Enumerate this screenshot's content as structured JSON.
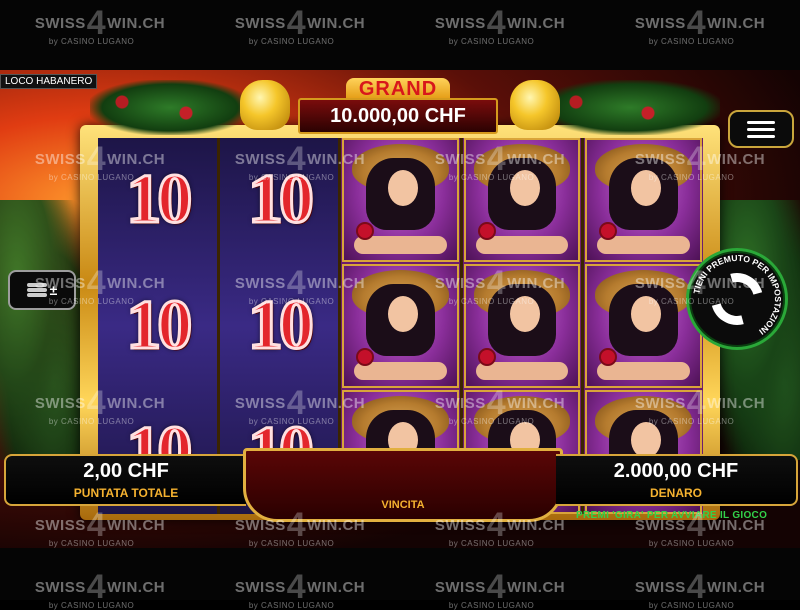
{
  "watermark": {
    "left": "SWISS",
    "right": "WIN.CH",
    "four": "4",
    "sub_left": "by CASINO",
    "sub_right": "LUGANO"
  },
  "game": {
    "title": "LOCO HABANERO",
    "jackpot": {
      "label": "GRAND",
      "value": "10.000,00 CHF"
    },
    "reels": [
      [
        "10",
        "10",
        "10"
      ],
      [
        "10",
        "10",
        "10"
      ],
      [
        "lady",
        "lady",
        "lady"
      ],
      [
        "lady",
        "lady",
        "lady"
      ],
      [
        "lady",
        "lady",
        "lady"
      ]
    ],
    "bet": {
      "value": "2,00 CHF",
      "label": "PUNTATA TOTALE"
    },
    "win": {
      "label": "VINCITA"
    },
    "balance": {
      "value": "2.000,00 CHF",
      "label": "DENARO"
    },
    "spin_button_text": "TIENI PREMUTO PER IMPOSTAZIONI",
    "hint": "PREMI 'GIRA' PER AVVIARE IL GIOCO",
    "icons": {
      "menu": "hamburger-menu-icon",
      "coins": "coin-stack-icon",
      "spin": "spin-arrows-icon"
    },
    "colors": {
      "accent_gold": "#d7a53a",
      "label_orange": "#f5b230",
      "hint_green": "#33d14a",
      "grand_red": "#d8171b"
    }
  }
}
